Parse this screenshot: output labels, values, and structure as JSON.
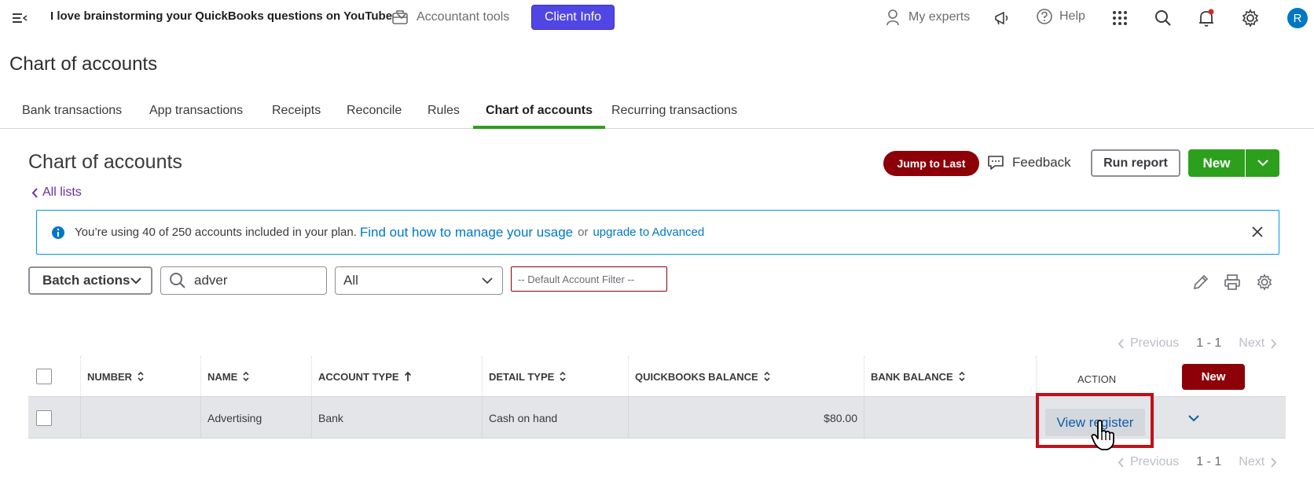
{
  "topbar": {
    "company": "I love brainstorming your QuickBooks questions on YouTube",
    "accountant_tools": "Accountant tools",
    "client_info": "Client Info",
    "my_experts": "My experts",
    "help": "Help",
    "avatar_initial": "R"
  },
  "page": {
    "title": "Chart of accounts"
  },
  "tabs": [
    {
      "label": "Bank transactions"
    },
    {
      "label": "App transactions"
    },
    {
      "label": "Receipts"
    },
    {
      "label": "Reconcile"
    },
    {
      "label": "Rules"
    },
    {
      "label": "Chart of accounts",
      "active": true
    },
    {
      "label": "Recurring transactions"
    }
  ],
  "section": {
    "title": "Chart of accounts",
    "jump_to_last": "Jump to Last",
    "feedback": "Feedback",
    "run_report": "Run report",
    "new": "New",
    "all_lists": "All lists"
  },
  "banner": {
    "text": "You’re using 40 of 250 accounts included in your plan.",
    "link_manage": "Find out how to manage your usage",
    "or": "or",
    "link_upgrade": "upgrade to Advanced"
  },
  "toolbar": {
    "batch_actions": "Batch actions",
    "search_value": "adver",
    "type_select": "All",
    "account_filter": "-- Default Account Filter --"
  },
  "pager": {
    "previous": "Previous",
    "count": "1 - 1",
    "next": "Next"
  },
  "table": {
    "headers": {
      "number": "NUMBER",
      "name": "NAME",
      "account_type": "ACCOUNT TYPE",
      "detail_type": "DETAIL TYPE",
      "qb_balance": "QUICKBOOKS BALANCE",
      "bank_balance": "BANK BALANCE",
      "action": "ACTION",
      "new": "New"
    },
    "rows": [
      {
        "number": "",
        "name": "Advertising",
        "account_type": "Bank",
        "detail_type": "Cash on hand",
        "qb_balance": "$80.00",
        "bank_balance": "",
        "action": "View register"
      }
    ]
  },
  "colors": {
    "brand_green": "#2ca01c",
    "dark_red": "#8d0007",
    "client_purple": "#5046e5",
    "link_blue": "#0077c5"
  }
}
